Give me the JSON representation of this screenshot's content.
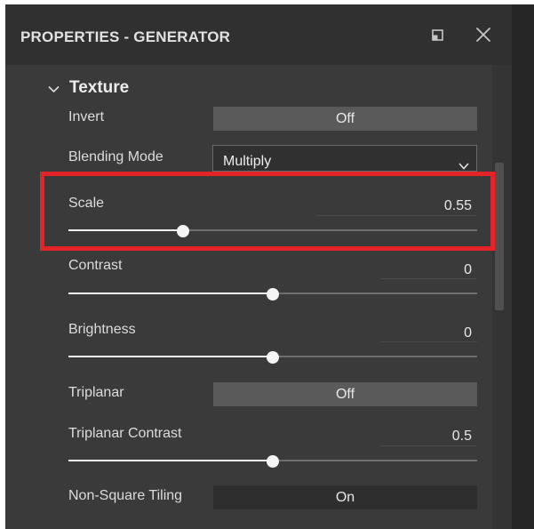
{
  "header": {
    "title": "PROPERTIES - GENERATOR"
  },
  "section": {
    "title": "Texture"
  },
  "invert": {
    "label": "Invert",
    "value": "Off"
  },
  "blending_mode": {
    "label": "Blending Mode",
    "value": "Multiply"
  },
  "scale": {
    "label": "Scale",
    "value": "0.55",
    "fraction": 0.28
  },
  "contrast": {
    "label": "Contrast",
    "value": "0",
    "fraction": 0.5
  },
  "brightness": {
    "label": "Brightness",
    "value": "0",
    "fraction": 0.5
  },
  "triplanar": {
    "label": "Triplanar",
    "value": "Off"
  },
  "triplanar_contrast": {
    "label": "Triplanar Contrast",
    "value": "0.5",
    "fraction": 0.5
  },
  "non_square_tiling": {
    "label": "Non-Square Tiling",
    "value": "On"
  },
  "colors": {
    "highlight": "#e4222a",
    "panel": "#3a3a3a",
    "header": "#303030"
  }
}
